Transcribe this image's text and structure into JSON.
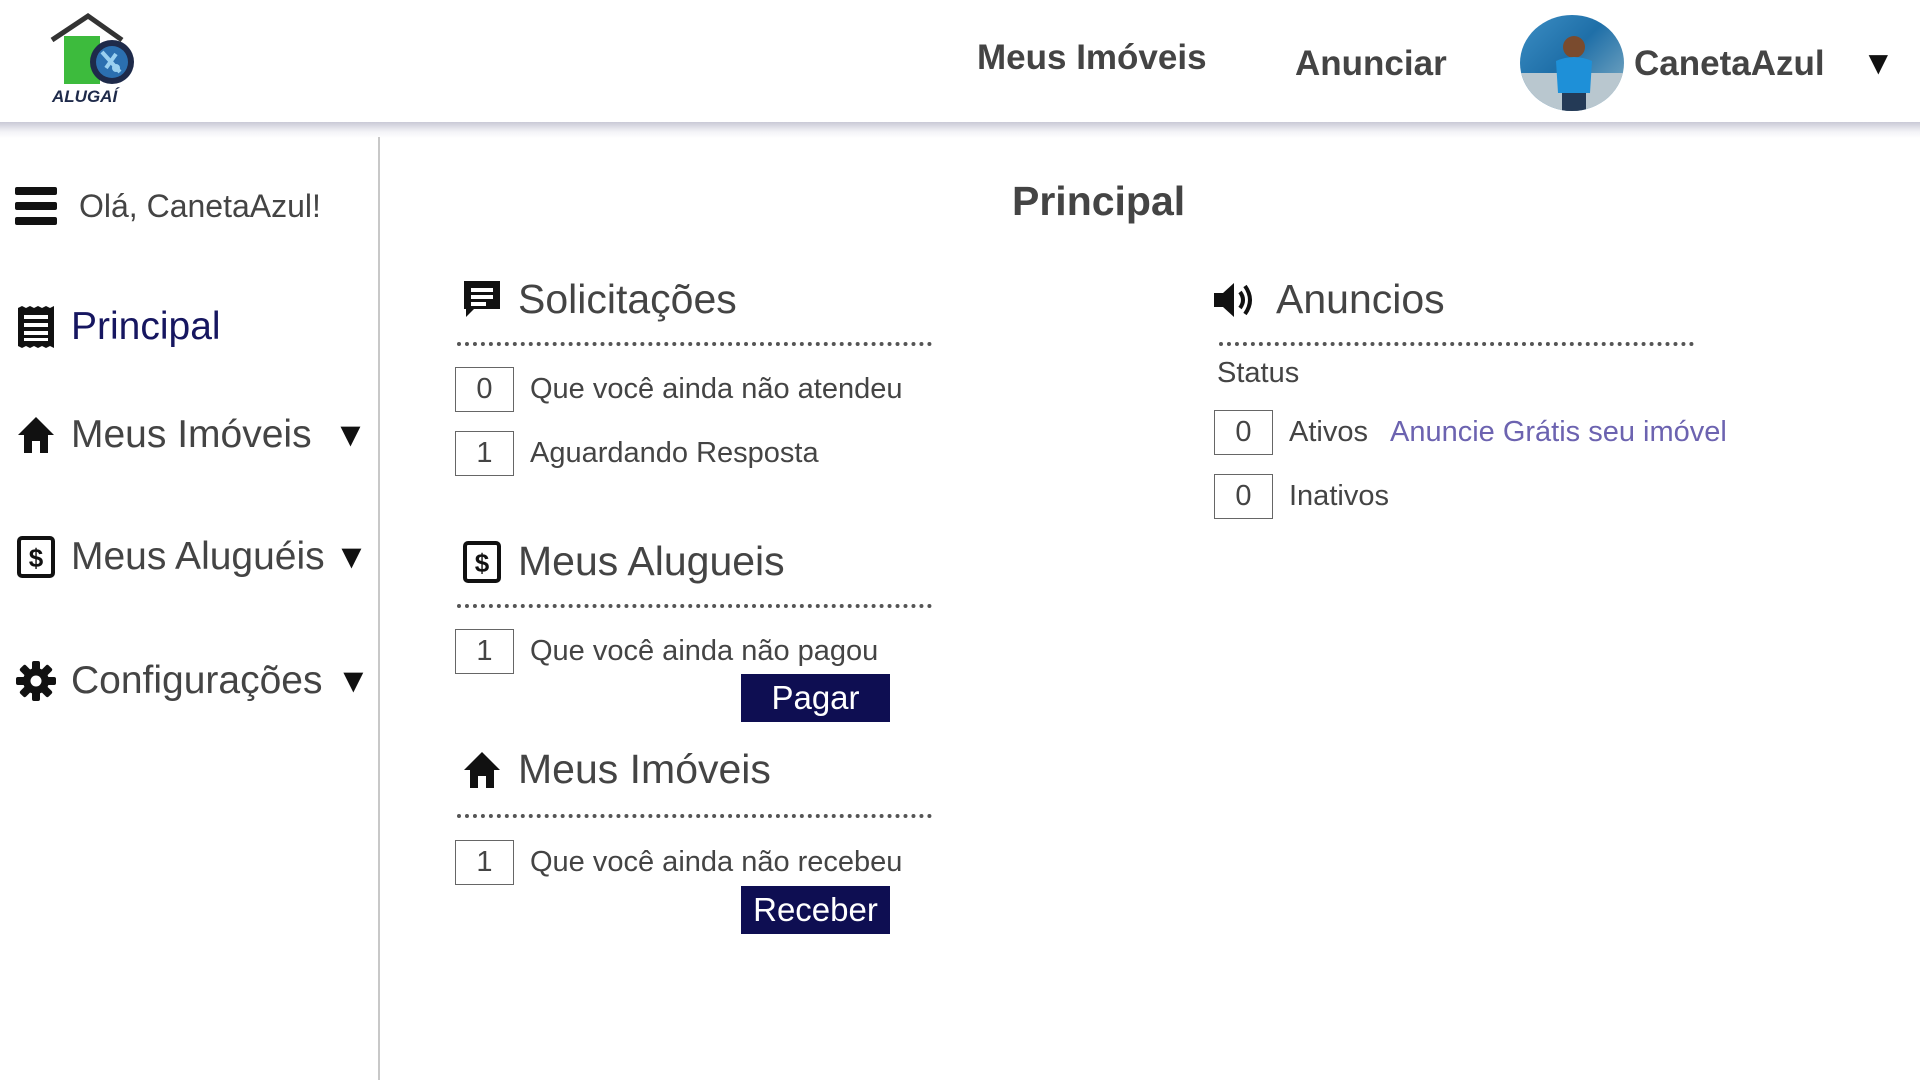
{
  "header": {
    "logo_text": "ALUGAÍ",
    "nav": {
      "meus_imoveis": "Meus Imóveis",
      "anunciar": "Anunciar"
    },
    "user": {
      "name": "CanetaAzul",
      "caret": "▼"
    }
  },
  "sidebar": {
    "greeting": "Olá, CanetaAzul!",
    "items": [
      {
        "label": "Principal",
        "icon": "receipt-icon",
        "active": true
      },
      {
        "label": "Meus Imóveis",
        "icon": "home-icon",
        "caret": "▼"
      },
      {
        "label": "Meus Aluguéis",
        "icon": "dollar-icon",
        "caret": "▼"
      },
      {
        "label": "Configurações",
        "icon": "gear-icon",
        "caret": "▼"
      }
    ]
  },
  "main": {
    "title": "Principal",
    "solicitacoes": {
      "title": "Solicitações",
      "rows": [
        {
          "value": "0",
          "label": "Que você ainda não atendeu"
        },
        {
          "value": "1",
          "label": "Aguardando Resposta"
        }
      ]
    },
    "alugueis": {
      "title": "Meus Alugueis",
      "rows": [
        {
          "value": "1",
          "label": "Que você ainda não pagou"
        }
      ],
      "button": "Pagar"
    },
    "imoveis": {
      "title": "Meus Imóveis",
      "rows": [
        {
          "value": "1",
          "label": "Que você ainda não recebeu"
        }
      ],
      "button": "Receber"
    },
    "anuncios": {
      "title": "Anuncios",
      "status_label": "Status",
      "rows": [
        {
          "value": "0",
          "label": "Ativos"
        },
        {
          "value": "0",
          "label": "Inativos"
        }
      ],
      "promo_link": "Anuncie Grátis seu imóvel"
    }
  },
  "colors": {
    "accent_dark": "#0e0e52",
    "active_nav": "#161660",
    "link": "#6c63b0",
    "logo_green": "#3dbb3d"
  }
}
